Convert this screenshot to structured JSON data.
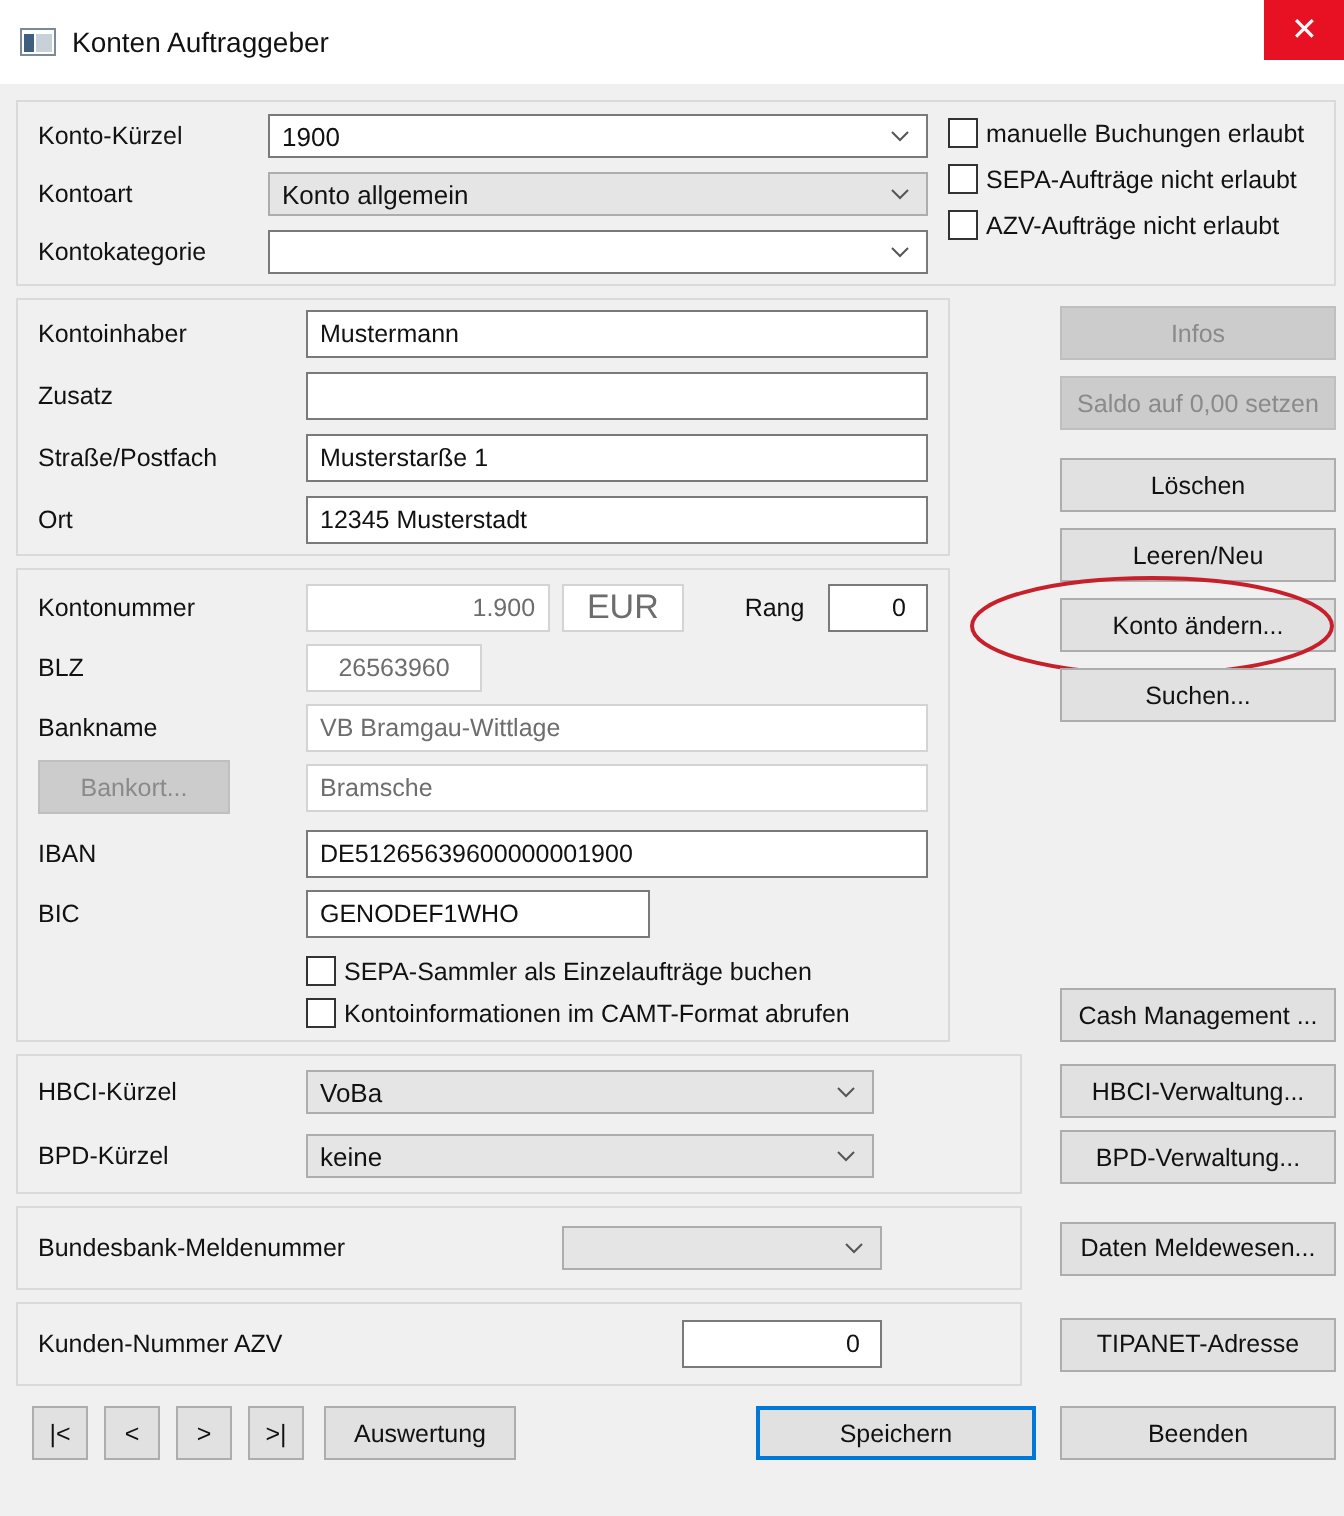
{
  "window": {
    "title": "Konten Auftraggeber",
    "close": "✕"
  },
  "account": {
    "fields": [
      {
        "label": "Konto-Kürzel",
        "value": "1900",
        "kind": "combo",
        "disabled": false
      },
      {
        "label": "Kontoart",
        "value": "Konto allgemein",
        "kind": "combo",
        "disabled": true
      },
      {
        "label": "Kontokategorie",
        "kind": "combo",
        "disabled": false
      }
    ],
    "options": [
      {
        "label": "manuelle Buchungen erlaubt",
        "checked": false
      },
      {
        "label": "SEPA-Aufträge nicht erlaubt",
        "checked": false
      },
      {
        "label": "AZV-Aufträge nicht erlaubt",
        "checked": false
      }
    ]
  },
  "holder": {
    "fields": [
      {
        "label": "Kontoinhaber",
        "value": "Mustermann"
      },
      {
        "label": "Zusatz"
      },
      {
        "label": "Straße/Postfach",
        "value": "Musterstarße 1"
      },
      {
        "label": "Ort",
        "value": "12345 Musterstadt"
      }
    ]
  },
  "side_buttons": [
    {
      "label": "Infos",
      "disabled": true,
      "circled": false
    },
    {
      "label": "Saldo auf 0,00 setzen",
      "disabled": true,
      "circled": false
    },
    {
      "label": "Löschen",
      "disabled": false,
      "circled": false
    },
    {
      "label": "Leeren/Neu",
      "disabled": false,
      "circled": false
    },
    {
      "label": "Konto ändern...",
      "disabled": false,
      "circled": true
    },
    {
      "label": "Suchen...",
      "disabled": false,
      "circled": false
    }
  ],
  "bank": {
    "account_number": {
      "label": "Kontonummer",
      "value": "1.900"
    },
    "currency": "EUR",
    "rank": {
      "label": "Rang",
      "value": "0"
    },
    "blz": {
      "label": "BLZ",
      "value": "26563960"
    },
    "bank_name": {
      "label": "Bankname",
      "value": "VB Bramgau-Wittlage"
    },
    "bank_place": {
      "button": "Bankort...",
      "value": "Bramsche"
    },
    "iban": {
      "label": "IBAN",
      "value": "DE51265639600000001900"
    },
    "bic": {
      "label": "BIC",
      "value": "GENODEF1WHO"
    },
    "options": [
      {
        "label": "SEPA-Sammler als Einzelaufträge buchen",
        "checked": false
      },
      {
        "label": "Kontoinformationen im CAMT-Format abrufen",
        "checked": false
      }
    ],
    "cash_button": "Cash Management ..."
  },
  "hbci": {
    "rows": [
      {
        "label": "HBCI-Kürzel",
        "value": "VoBa",
        "button": "HBCI-Verwaltung..."
      },
      {
        "label": "BPD-Kürzel",
        "value": "keine",
        "button": "BPD-Verwaltung..."
      }
    ]
  },
  "bundesbank": {
    "label": "Bundesbank-Meldenummer",
    "button": "Daten Meldewesen..."
  },
  "azv": {
    "label": "Kunden-Nummer AZV",
    "value": "0",
    "button": "TIPANET-Adresse"
  },
  "footer": {
    "nav": [
      "|<",
      "<",
      ">",
      ">|"
    ],
    "report": "Auswertung",
    "save": "Speichern",
    "close": "Beenden"
  }
}
